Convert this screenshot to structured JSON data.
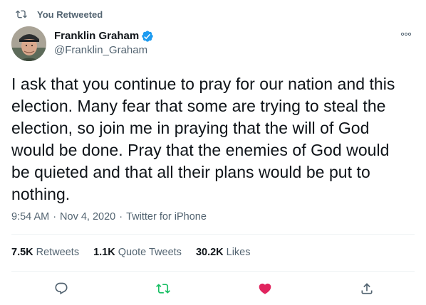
{
  "retweet_header": {
    "label": "You Retweeted"
  },
  "author": {
    "name": "Franklin Graham",
    "handle": "@Franklin_Graham"
  },
  "tweet": {
    "text": "I ask that you continue to pray for our nation and this election. Many fear that some are trying to steal the election, so join me in praying that the will of God would be done. Pray that the enemies of God would be quieted and that all their plans would be put to nothing."
  },
  "meta": {
    "time": "9:54 AM",
    "date": "Nov 4, 2020",
    "source": "Twitter for iPhone",
    "separator": "·"
  },
  "stats": {
    "retweets_count": "7.5K",
    "retweets_label": "Retweets",
    "quotes_count": "1.1K",
    "quotes_label": "Quote Tweets",
    "likes_count": "30.2K",
    "likes_label": "Likes"
  },
  "icons": {
    "retweet_header": "retweet-icon",
    "verified": "verified-badge-icon",
    "more": "more-options-icon",
    "reply": "reply-icon",
    "retweet_action": "retweet-icon",
    "like_action": "heart-icon",
    "share": "share-icon"
  },
  "colors": {
    "retweeted_green": "#17bf63",
    "liked_red": "#e0245e",
    "verified_blue": "#1d9bf0",
    "secondary_text": "#536471"
  }
}
